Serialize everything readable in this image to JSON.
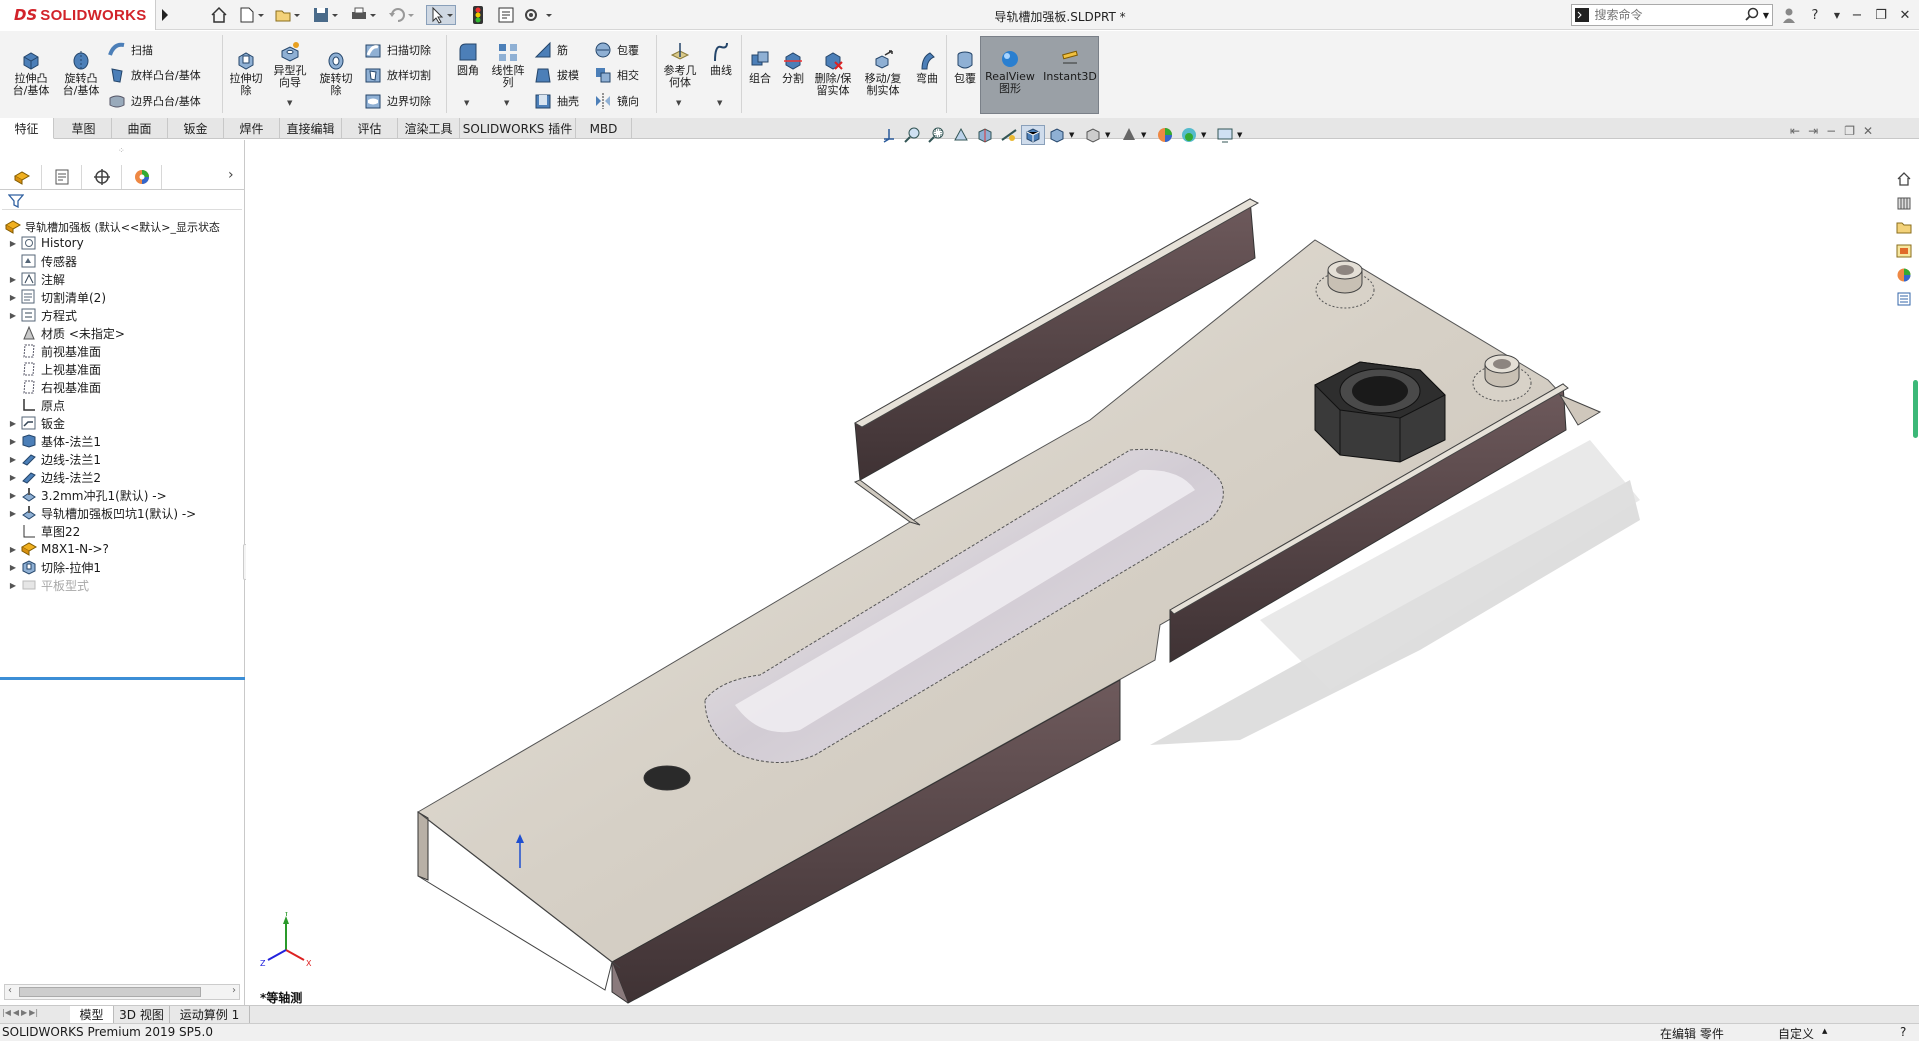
{
  "app": {
    "logo_ds": "DS",
    "logo_text": "SOLIDWORKS",
    "document_title": "导轨槽加强板.SLDPRT *",
    "search_placeholder": "搜索命令"
  },
  "ribbon": {
    "extrude_boss": [
      "拉伸凸",
      "台/基体"
    ],
    "revolve_boss": [
      "旋转凸",
      "台/基体"
    ],
    "sweep": "扫描",
    "loft_boss": "放样凸台/基体",
    "boundary_boss": "边界凸台/基体",
    "extrude_cut": [
      "拉伸切",
      "除"
    ],
    "hole_wizard": [
      "异型孔",
      "向导"
    ],
    "revolve_cut": [
      "旋转切",
      "除"
    ],
    "sweep_cut": "扫描切除",
    "loft_cut": "放样切割",
    "boundary_cut": "边界切除",
    "fillet": "圆角",
    "linear_pattern": [
      "线性阵",
      "列"
    ],
    "rib": "筋",
    "draft": "拔模",
    "shell": "抽壳",
    "wrap": "包覆",
    "intersect": "相交",
    "mirror": "镜向",
    "ref_geometry": [
      "参考几",
      "何体"
    ],
    "curves": "曲线",
    "combine": "组合",
    "split": "分割",
    "delete_keep_body": [
      "删除/保",
      "留实体"
    ],
    "move_copy": [
      "移动/复",
      "制实体"
    ],
    "flex": "弯曲",
    "wrap2": "包覆",
    "realview": [
      "RealView",
      "图形"
    ],
    "instant3d": "Instant3D"
  },
  "tabs": [
    "特征",
    "草图",
    "曲面",
    "钣金",
    "焊件",
    "直接编辑",
    "评估",
    "渲染工具",
    "SOLIDWORKS 插件",
    "MBD"
  ],
  "tree": {
    "root": "导轨槽加强板  (默认<<默认>_显示状态",
    "items": [
      {
        "label": "History",
        "icon": "history-icon",
        "expand": true,
        "grey": false
      },
      {
        "label": "传感器",
        "icon": "sensor-icon",
        "expand": false,
        "grey": false
      },
      {
        "label": "注解",
        "icon": "annotation-icon",
        "expand": true,
        "grey": false
      },
      {
        "label": "切割清单(2)",
        "icon": "cutlist-icon",
        "expand": true,
        "grey": false
      },
      {
        "label": "方程式",
        "icon": "equation-icon",
        "expand": true,
        "grey": false
      },
      {
        "label": "材质 <未指定>",
        "icon": "material-icon",
        "expand": false,
        "grey": false
      },
      {
        "label": "前视基准面",
        "icon": "plane-icon",
        "expand": false,
        "grey": false
      },
      {
        "label": "上视基准面",
        "icon": "plane-icon",
        "expand": false,
        "grey": false
      },
      {
        "label": "右视基准面",
        "icon": "plane-icon",
        "expand": false,
        "grey": false
      },
      {
        "label": "原点",
        "icon": "origin-icon",
        "expand": false,
        "grey": false
      },
      {
        "label": "钣金",
        "icon": "sheetmetal-icon",
        "expand": true,
        "grey": false
      },
      {
        "label": "基体-法兰1",
        "icon": "base-flange-icon",
        "expand": true,
        "grey": false
      },
      {
        "label": "边线-法兰1",
        "icon": "edge-flange-icon",
        "expand": true,
        "grey": false
      },
      {
        "label": "边线-法兰2",
        "icon": "edge-flange-icon",
        "expand": true,
        "grey": false
      },
      {
        "label": "3.2mm冲孔1(默认) ->",
        "icon": "forming-tool-icon",
        "expand": true,
        "grey": false
      },
      {
        "label": "导轨槽加强板凹坑1(默认) ->",
        "icon": "forming-tool-icon",
        "expand": true,
        "grey": false
      },
      {
        "label": "草图22",
        "icon": "sketch-icon",
        "expand": false,
        "grey": false
      },
      {
        "label": "M8X1-N->?",
        "icon": "part-icon",
        "expand": true,
        "grey": false
      },
      {
        "label": "切除-拉伸1",
        "icon": "cut-extrude-icon",
        "expand": true,
        "grey": false
      },
      {
        "label": "平板型式",
        "icon": "flat-pattern-icon",
        "expand": true,
        "grey": true
      }
    ]
  },
  "viewport": {
    "view_label": "*等轴测"
  },
  "bottom_tabs": [
    "模型",
    "3D 视图",
    "运动算例 1"
  ],
  "status": {
    "version": "SOLIDWORKS Premium 2019 SP5.0",
    "mode": "在编辑 零件",
    "custom": "自定义"
  },
  "colors": {
    "brand_red": "#d2232a",
    "selection_blue": "#3c8ed6",
    "part_face": "#ddd8cf",
    "part_wall": "#5a4a4c"
  }
}
